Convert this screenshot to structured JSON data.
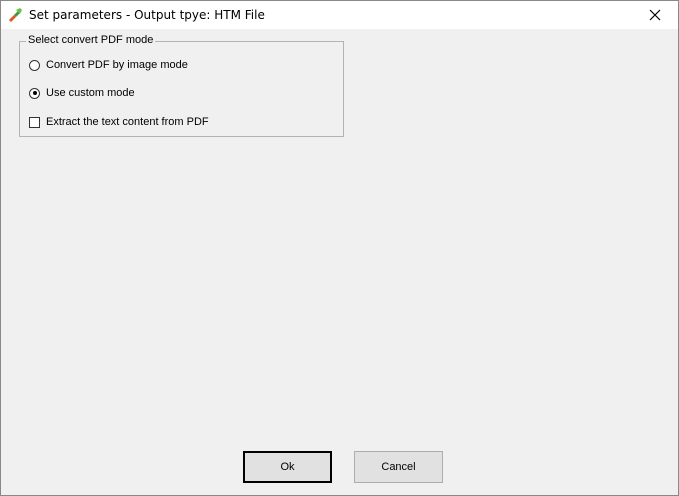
{
  "window": {
    "title": "Set parameters - Output tpye: HTM File",
    "icon": "app-icon",
    "close_icon": "close-icon"
  },
  "group": {
    "legend": "Select convert PDF mode",
    "options": [
      {
        "label": "Convert PDF by image mode",
        "type": "radio",
        "checked": false
      },
      {
        "label": "Use custom mode",
        "type": "radio",
        "checked": true
      },
      {
        "label": "Extract the text content from PDF",
        "type": "checkbox",
        "checked": false
      }
    ]
  },
  "buttons": {
    "ok_label": "Ok",
    "cancel_label": "Cancel"
  }
}
